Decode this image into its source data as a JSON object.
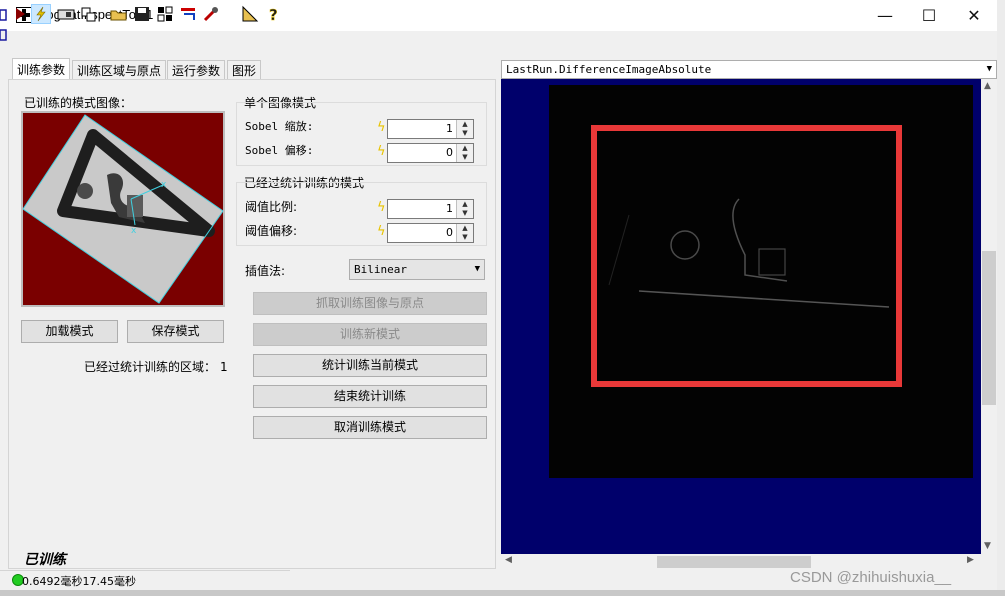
{
  "window": {
    "title": "CogPatInspectTool1",
    "minimize": "—",
    "maximize": "☐",
    "close": "✕"
  },
  "toolbar": {
    "icons": [
      "run-icon",
      "train-icon",
      "display-icon",
      "copy-icon",
      "open-icon",
      "save-icon",
      "grid-icon",
      "reset-icon",
      "wrench-icon",
      "ruler-icon",
      "help-icon"
    ]
  },
  "tabs": [
    "训练参数",
    "训练区域与原点",
    "运行参数",
    "图形"
  ],
  "left": {
    "model_image_label": "已训练的模式图像：",
    "load_button": "加载模式",
    "save_button": "保存模式",
    "stat_region_label": "已经过统计训练的区域：",
    "stat_region_count": "1",
    "trained_status": "已训练"
  },
  "single_image": {
    "heading": "单个图像模式",
    "sobel_scale_label": "Sobel 缩放:",
    "sobel_scale_value": "1",
    "sobel_offset_label": "Sobel 偏移:",
    "sobel_offset_value": "0"
  },
  "stat_model": {
    "heading": "已经过统计训练的模式",
    "threshold_scale_label": "阈值比例:",
    "threshold_scale_value": "1",
    "threshold_offset_label": "阈值偏移:",
    "threshold_offset_value": "0"
  },
  "interp": {
    "label": "插值法:",
    "value": "Bilinear"
  },
  "actions": {
    "grab": "抓取训练图像与原点",
    "train_new": "训练新模式",
    "stat_train": "统计训练当前模式",
    "end_train": "结束统计训练",
    "cancel_train": "取消训练模式"
  },
  "display": {
    "selector": "LastRun.DifferenceImageAbsolute"
  },
  "status": {
    "time": "0.6492毫秒17.45毫秒"
  },
  "watermark": "CSDN @zhihuishuxia__",
  "colors": {
    "highlight": "#e83838",
    "display_bg": "#00006b",
    "model_bg": "#7a0000",
    "led": "#22cc22"
  }
}
